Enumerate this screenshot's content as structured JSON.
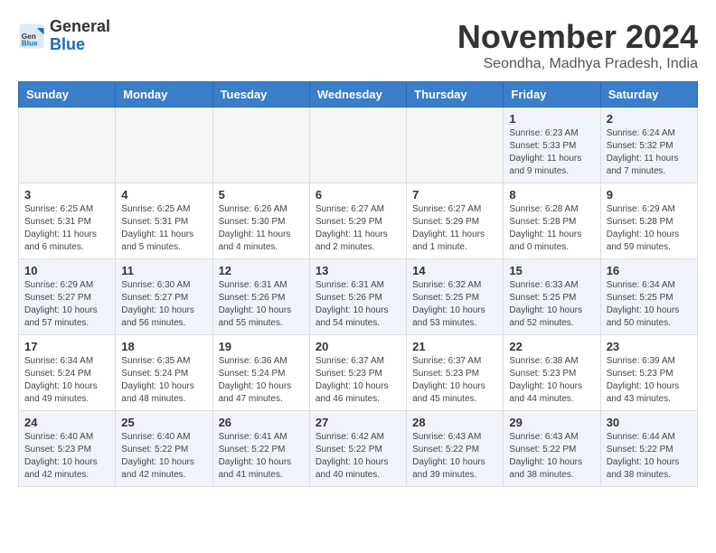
{
  "logo": {
    "general": "General",
    "blue": "Blue"
  },
  "title": "November 2024",
  "subtitle": "Seondha, Madhya Pradesh, India",
  "weekdays": [
    "Sunday",
    "Monday",
    "Tuesday",
    "Wednesday",
    "Thursday",
    "Friday",
    "Saturday"
  ],
  "weeks": [
    [
      {
        "day": "",
        "info": ""
      },
      {
        "day": "",
        "info": ""
      },
      {
        "day": "",
        "info": ""
      },
      {
        "day": "",
        "info": ""
      },
      {
        "day": "",
        "info": ""
      },
      {
        "day": "1",
        "info": "Sunrise: 6:23 AM\nSunset: 5:33 PM\nDaylight: 11 hours and 9 minutes."
      },
      {
        "day": "2",
        "info": "Sunrise: 6:24 AM\nSunset: 5:32 PM\nDaylight: 11 hours and 7 minutes."
      }
    ],
    [
      {
        "day": "3",
        "info": "Sunrise: 6:25 AM\nSunset: 5:31 PM\nDaylight: 11 hours and 6 minutes."
      },
      {
        "day": "4",
        "info": "Sunrise: 6:25 AM\nSunset: 5:31 PM\nDaylight: 11 hours and 5 minutes."
      },
      {
        "day": "5",
        "info": "Sunrise: 6:26 AM\nSunset: 5:30 PM\nDaylight: 11 hours and 4 minutes."
      },
      {
        "day": "6",
        "info": "Sunrise: 6:27 AM\nSunset: 5:29 PM\nDaylight: 11 hours and 2 minutes."
      },
      {
        "day": "7",
        "info": "Sunrise: 6:27 AM\nSunset: 5:29 PM\nDaylight: 11 hours and 1 minute."
      },
      {
        "day": "8",
        "info": "Sunrise: 6:28 AM\nSunset: 5:28 PM\nDaylight: 11 hours and 0 minutes."
      },
      {
        "day": "9",
        "info": "Sunrise: 6:29 AM\nSunset: 5:28 PM\nDaylight: 10 hours and 59 minutes."
      }
    ],
    [
      {
        "day": "10",
        "info": "Sunrise: 6:29 AM\nSunset: 5:27 PM\nDaylight: 10 hours and 57 minutes."
      },
      {
        "day": "11",
        "info": "Sunrise: 6:30 AM\nSunset: 5:27 PM\nDaylight: 10 hours and 56 minutes."
      },
      {
        "day": "12",
        "info": "Sunrise: 6:31 AM\nSunset: 5:26 PM\nDaylight: 10 hours and 55 minutes."
      },
      {
        "day": "13",
        "info": "Sunrise: 6:31 AM\nSunset: 5:26 PM\nDaylight: 10 hours and 54 minutes."
      },
      {
        "day": "14",
        "info": "Sunrise: 6:32 AM\nSunset: 5:25 PM\nDaylight: 10 hours and 53 minutes."
      },
      {
        "day": "15",
        "info": "Sunrise: 6:33 AM\nSunset: 5:25 PM\nDaylight: 10 hours and 52 minutes."
      },
      {
        "day": "16",
        "info": "Sunrise: 6:34 AM\nSunset: 5:25 PM\nDaylight: 10 hours and 50 minutes."
      }
    ],
    [
      {
        "day": "17",
        "info": "Sunrise: 6:34 AM\nSunset: 5:24 PM\nDaylight: 10 hours and 49 minutes."
      },
      {
        "day": "18",
        "info": "Sunrise: 6:35 AM\nSunset: 5:24 PM\nDaylight: 10 hours and 48 minutes."
      },
      {
        "day": "19",
        "info": "Sunrise: 6:36 AM\nSunset: 5:24 PM\nDaylight: 10 hours and 47 minutes."
      },
      {
        "day": "20",
        "info": "Sunrise: 6:37 AM\nSunset: 5:23 PM\nDaylight: 10 hours and 46 minutes."
      },
      {
        "day": "21",
        "info": "Sunrise: 6:37 AM\nSunset: 5:23 PM\nDaylight: 10 hours and 45 minutes."
      },
      {
        "day": "22",
        "info": "Sunrise: 6:38 AM\nSunset: 5:23 PM\nDaylight: 10 hours and 44 minutes."
      },
      {
        "day": "23",
        "info": "Sunrise: 6:39 AM\nSunset: 5:23 PM\nDaylight: 10 hours and 43 minutes."
      }
    ],
    [
      {
        "day": "24",
        "info": "Sunrise: 6:40 AM\nSunset: 5:23 PM\nDaylight: 10 hours and 42 minutes."
      },
      {
        "day": "25",
        "info": "Sunrise: 6:40 AM\nSunset: 5:22 PM\nDaylight: 10 hours and 42 minutes."
      },
      {
        "day": "26",
        "info": "Sunrise: 6:41 AM\nSunset: 5:22 PM\nDaylight: 10 hours and 41 minutes."
      },
      {
        "day": "27",
        "info": "Sunrise: 6:42 AM\nSunset: 5:22 PM\nDaylight: 10 hours and 40 minutes."
      },
      {
        "day": "28",
        "info": "Sunrise: 6:43 AM\nSunset: 5:22 PM\nDaylight: 10 hours and 39 minutes."
      },
      {
        "day": "29",
        "info": "Sunrise: 6:43 AM\nSunset: 5:22 PM\nDaylight: 10 hours and 38 minutes."
      },
      {
        "day": "30",
        "info": "Sunrise: 6:44 AM\nSunset: 5:22 PM\nDaylight: 10 hours and 38 minutes."
      }
    ]
  ]
}
